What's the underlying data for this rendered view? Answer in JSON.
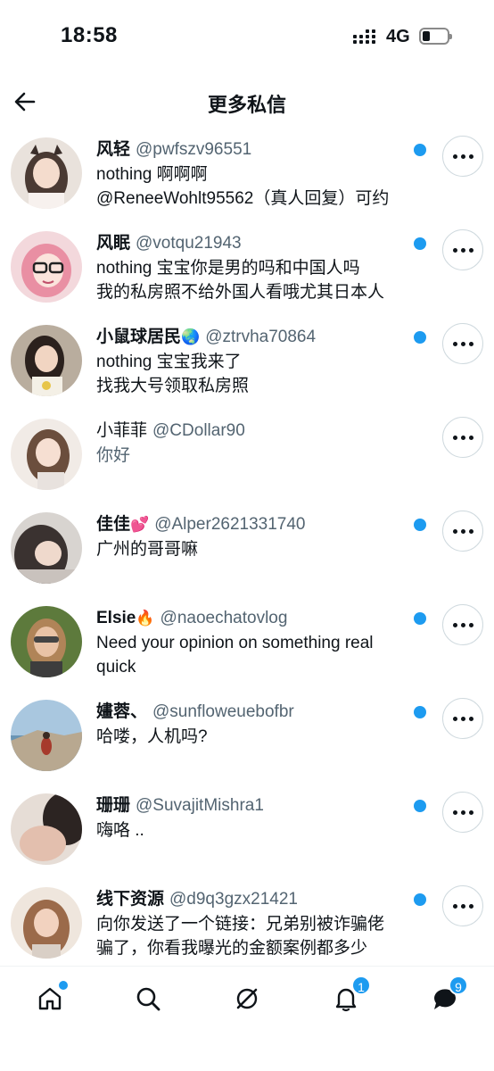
{
  "status_bar": {
    "time": "18:58",
    "network": "4G"
  },
  "header": {
    "title": "更多私信"
  },
  "conversations": [
    {
      "name": "风轻",
      "emoji": "",
      "handle": "@pwfszv96551",
      "lines": [
        "nothing 啊啊啊",
        "@ReneeWohlt95562（真人回复）可约"
      ],
      "unread": true
    },
    {
      "name": "风眠",
      "emoji": "",
      "handle": "@votqu21943",
      "lines": [
        "nothing 宝宝你是男的吗和中国人吗",
        "我的私房照不给外国人看哦尤其日本人"
      ],
      "unread": true
    },
    {
      "name": "小鼠球居民",
      "emoji": "🌏",
      "handle": "@ztrvha70864",
      "lines": [
        "nothing 宝宝我来了",
        "找我大号领取私房照"
      ],
      "unread": true
    },
    {
      "name": "小菲菲",
      "emoji": "",
      "handle": "@CDollar90",
      "lines": [
        "你好"
      ],
      "unread": false
    },
    {
      "name": "佳佳",
      "emoji": "💕",
      "handle": "@Alper2621331740",
      "lines": [
        "广州的哥哥嘛"
      ],
      "unread": true
    },
    {
      "name": "Elsie",
      "emoji": "🔥",
      "handle": "@naoechatovlog",
      "lines": [
        "Need your opinion on something real",
        "quick"
      ],
      "unread": true
    },
    {
      "name": "嫿蓉、",
      "emoji": "",
      "handle": "@sunfloweuebofbr",
      "lines": [
        "哈喽，人机吗?"
      ],
      "unread": true
    },
    {
      "name": "珊珊",
      "emoji": "",
      "handle": "@SuvajitMishra1",
      "lines": [
        "嗨咯 .."
      ],
      "unread": true
    },
    {
      "name": "线下资源",
      "emoji": "",
      "handle": "@d9q3gzx21421",
      "lines": [
        "向你发送了一个链接：兄弟别被诈骗佬",
        "骗了，你看我曝光的金额案例都多少"
      ],
      "unread": true
    }
  ],
  "bottom_nav": {
    "items": [
      "home-icon",
      "search-icon",
      "grok-icon",
      "notifications-icon",
      "messages-icon"
    ],
    "notifications_badge": "1",
    "messages_badge": "9"
  },
  "colors": {
    "accent": "#1d9bf0",
    "secondary_text": "#536471",
    "primary_text": "#0f1419"
  }
}
